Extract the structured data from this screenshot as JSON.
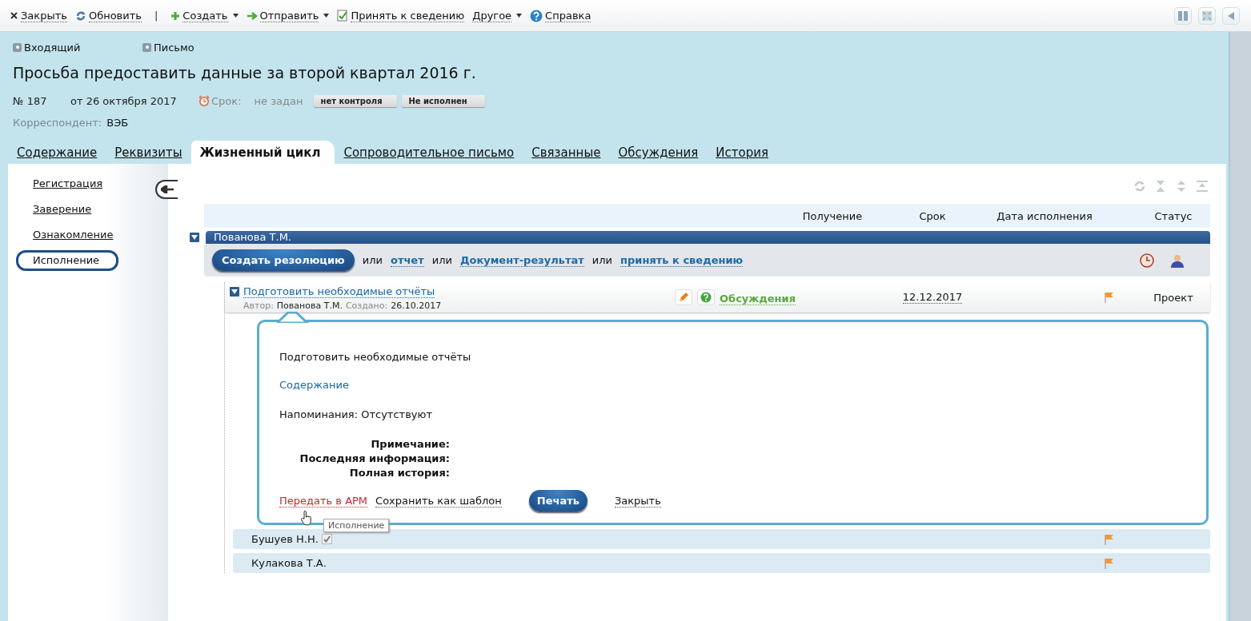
{
  "toolbar": {
    "items": [
      {
        "kind": "close",
        "label": "Закрыть",
        "dropdown": false
      },
      {
        "kind": "refresh",
        "label": "Обновить",
        "dropdown": false
      },
      {
        "kind": "separator",
        "label": "|"
      },
      {
        "kind": "create",
        "label": "Создать",
        "dropdown": true
      },
      {
        "kind": "send",
        "label": "Отправить",
        "dropdown": true
      },
      {
        "kind": "acknowledge",
        "label": "Принять к сведению",
        "dropdown": false
      },
      {
        "kind": "plain",
        "label": "Другое",
        "dropdown": true
      },
      {
        "kind": "help",
        "label": "Справка",
        "dropdown": false
      }
    ]
  },
  "document": {
    "type_badges": [
      "Входящий",
      "Письмо"
    ],
    "title": "Просьба предоставить данные за второй квартал 2016 г.",
    "number": "№ 187",
    "date": "от 26 октября 2017",
    "deadline_label": "Срок:",
    "deadline_value": "не задан",
    "status_tags": [
      "нет контроля",
      "Не исполнен"
    ],
    "correspondent_label": "Корреспондент:",
    "correspondent": "ВЭБ"
  },
  "tabs": [
    {
      "label": "Содержание",
      "selected": false
    },
    {
      "label": "Реквизиты",
      "selected": false
    },
    {
      "label": "Жизненный цикл",
      "selected": true
    },
    {
      "label": "Сопроводительное письмо",
      "selected": false
    },
    {
      "label": "Связанные",
      "selected": false
    },
    {
      "label": "Обсуждения",
      "selected": false
    },
    {
      "label": "История",
      "selected": false
    }
  ],
  "sidebar": {
    "items": [
      {
        "label": "Регистрация",
        "selected": false
      },
      {
        "label": "Заверение",
        "selected": false
      },
      {
        "label": "Ознакомление",
        "selected": false
      },
      {
        "label": "Исполнение",
        "selected": true
      }
    ]
  },
  "table": {
    "columns": [
      "Получение",
      "Срок",
      "Дата исполнения",
      "Статус"
    ]
  },
  "group": {
    "name": "Пованова Т.М.",
    "expanded": true,
    "action_button": "Создать резолюцию",
    "actions": [
      {
        "kind": "text",
        "text": "или"
      },
      {
        "kind": "link",
        "text": "отчет"
      },
      {
        "kind": "text",
        "text": "или"
      },
      {
        "kind": "link",
        "text": "Документ-результат"
      },
      {
        "kind": "text",
        "text": "или"
      },
      {
        "kind": "link",
        "text": "принять к сведению"
      }
    ]
  },
  "task": {
    "title": "Подготовить необходимые отчёты",
    "expanded": true,
    "author_label": "Автор:",
    "author": "Пованова Т.М.",
    "created_label": "Создано:",
    "created": "26.10.2017",
    "discussions": "Обсуждения",
    "deadline": "12.12.2017",
    "status": "Проект"
  },
  "detail": {
    "text": "Подготовить необходимые отчёты",
    "content_link": "Содержание",
    "reminders": "Напоминания: Отсутствуют",
    "fields": [
      "Примечание:",
      "Последняя информация:",
      "Полная история:"
    ],
    "actions": [
      {
        "kind": "danger-link",
        "text": "Передать в АРМ"
      },
      {
        "kind": "link",
        "text": "Сохранить как шаблон"
      },
      {
        "kind": "button",
        "text": "Печать"
      },
      {
        "kind": "link",
        "text": "Закрыть"
      }
    ],
    "tooltip": "Исполнение"
  },
  "subtasks": [
    {
      "name": "Бушуев Н.Н.",
      "confirmed": true
    },
    {
      "name": "Кулакова Т.А.",
      "confirmed": false
    }
  ]
}
